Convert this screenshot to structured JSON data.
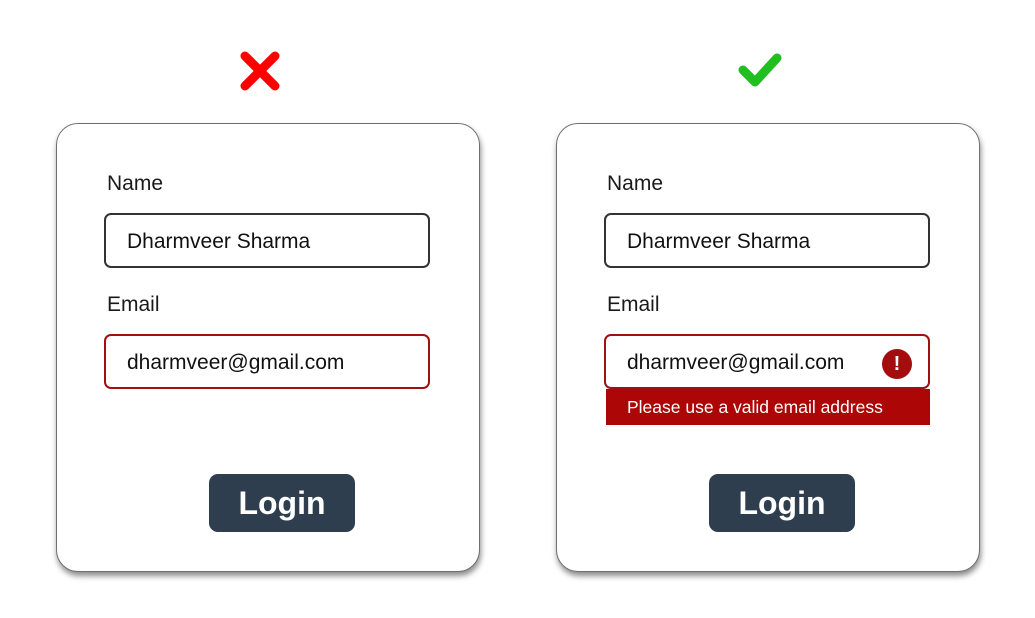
{
  "colors": {
    "bad_marker": "#ff0000",
    "good_marker": "#1fbf1f",
    "error_red": "#ad0606",
    "button_bg": "#2f3e4f"
  },
  "panels": [
    {
      "marker_icon": "cross-icon",
      "form": {
        "name_label": "Name",
        "name_value": "Dharmveer Sharma",
        "email_label": "Email",
        "email_value": "dharmveer@gmail.com",
        "login_label": "Login"
      }
    },
    {
      "marker_icon": "checkmark-icon",
      "form": {
        "name_label": "Name",
        "name_value": "Dharmveer Sharma",
        "email_label": "Email",
        "email_value": "dharmveer@gmail.com",
        "error_icon": "exclamation-icon",
        "error_glyph": "!",
        "error_message": "Please use a valid email address",
        "login_label": "Login"
      }
    }
  ]
}
